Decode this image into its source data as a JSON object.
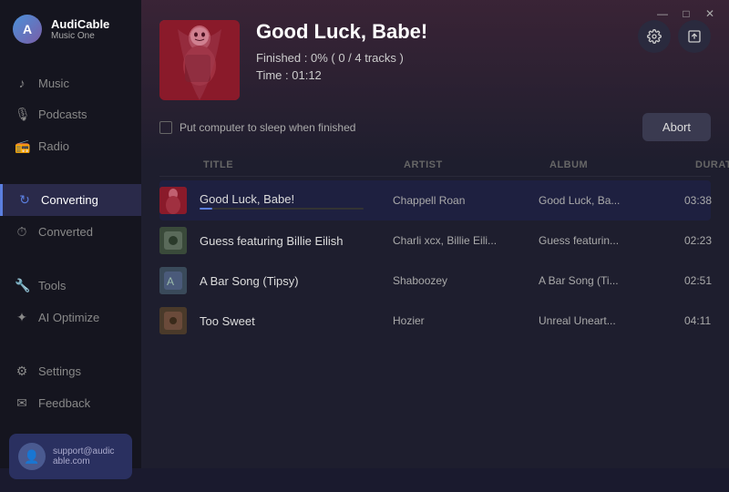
{
  "app": {
    "name": "AudiCable",
    "subtitle": "Music One"
  },
  "titlebar": {
    "minimize": "—",
    "maximize": "□",
    "close": "✕"
  },
  "sidebar": {
    "items": [
      {
        "id": "music",
        "label": "Music",
        "icon": "♪"
      },
      {
        "id": "podcasts",
        "label": "Podcasts",
        "icon": "🎙"
      },
      {
        "id": "radio",
        "label": "Radio",
        "icon": "📻"
      },
      {
        "id": "converting",
        "label": "Converting",
        "icon": "↻",
        "active": true
      },
      {
        "id": "converted",
        "label": "Converted",
        "icon": "⏱"
      },
      {
        "id": "tools",
        "label": "Tools",
        "icon": "🔧"
      },
      {
        "id": "ai-optimize",
        "label": "AI Optimize",
        "icon": "✦"
      },
      {
        "id": "settings",
        "label": "Settings",
        "icon": "⚙"
      },
      {
        "id": "feedback",
        "label": "Feedback",
        "icon": "✉"
      }
    ],
    "user": {
      "email": "support@audic able.com",
      "email_display": "support@audic\nable.com"
    }
  },
  "main": {
    "track": {
      "title": "Good Luck, Babe!",
      "finished_label": "Finished : 0% ( 0 / 4 tracks )",
      "time_label": "Time : 01:12"
    },
    "sleep_label": "Put computer to sleep when finished",
    "abort_label": "Abort",
    "table": {
      "columns": [
        "TITLE",
        "ARTIST",
        "ALBUM",
        "DURATION"
      ],
      "rows": [
        {
          "title": "Good Luck, Babe!",
          "artist": "Chappell Roan",
          "album": "Good Luck, Ba...",
          "duration": "03:38",
          "active": true,
          "progress": 8,
          "thumb_color": "#c0394a"
        },
        {
          "title": "Guess featuring Billie Eilish",
          "artist": "Charli xcx, Billie Eili...",
          "album": "Guess featurin...",
          "duration": "02:23",
          "active": false,
          "progress": 0,
          "thumb_color": "#5a6a4a"
        },
        {
          "title": "A Bar Song (Tipsy)",
          "artist": "Shaboozey",
          "album": "A Bar Song (Ti...",
          "duration": "02:51",
          "active": false,
          "progress": 0,
          "thumb_color": "#4a5a6a"
        },
        {
          "title": "Too Sweet",
          "artist": "Hozier",
          "album": "Unreal Uneart...",
          "duration": "04:11",
          "active": false,
          "progress": 0,
          "thumb_color": "#6a4a3a"
        }
      ]
    }
  }
}
